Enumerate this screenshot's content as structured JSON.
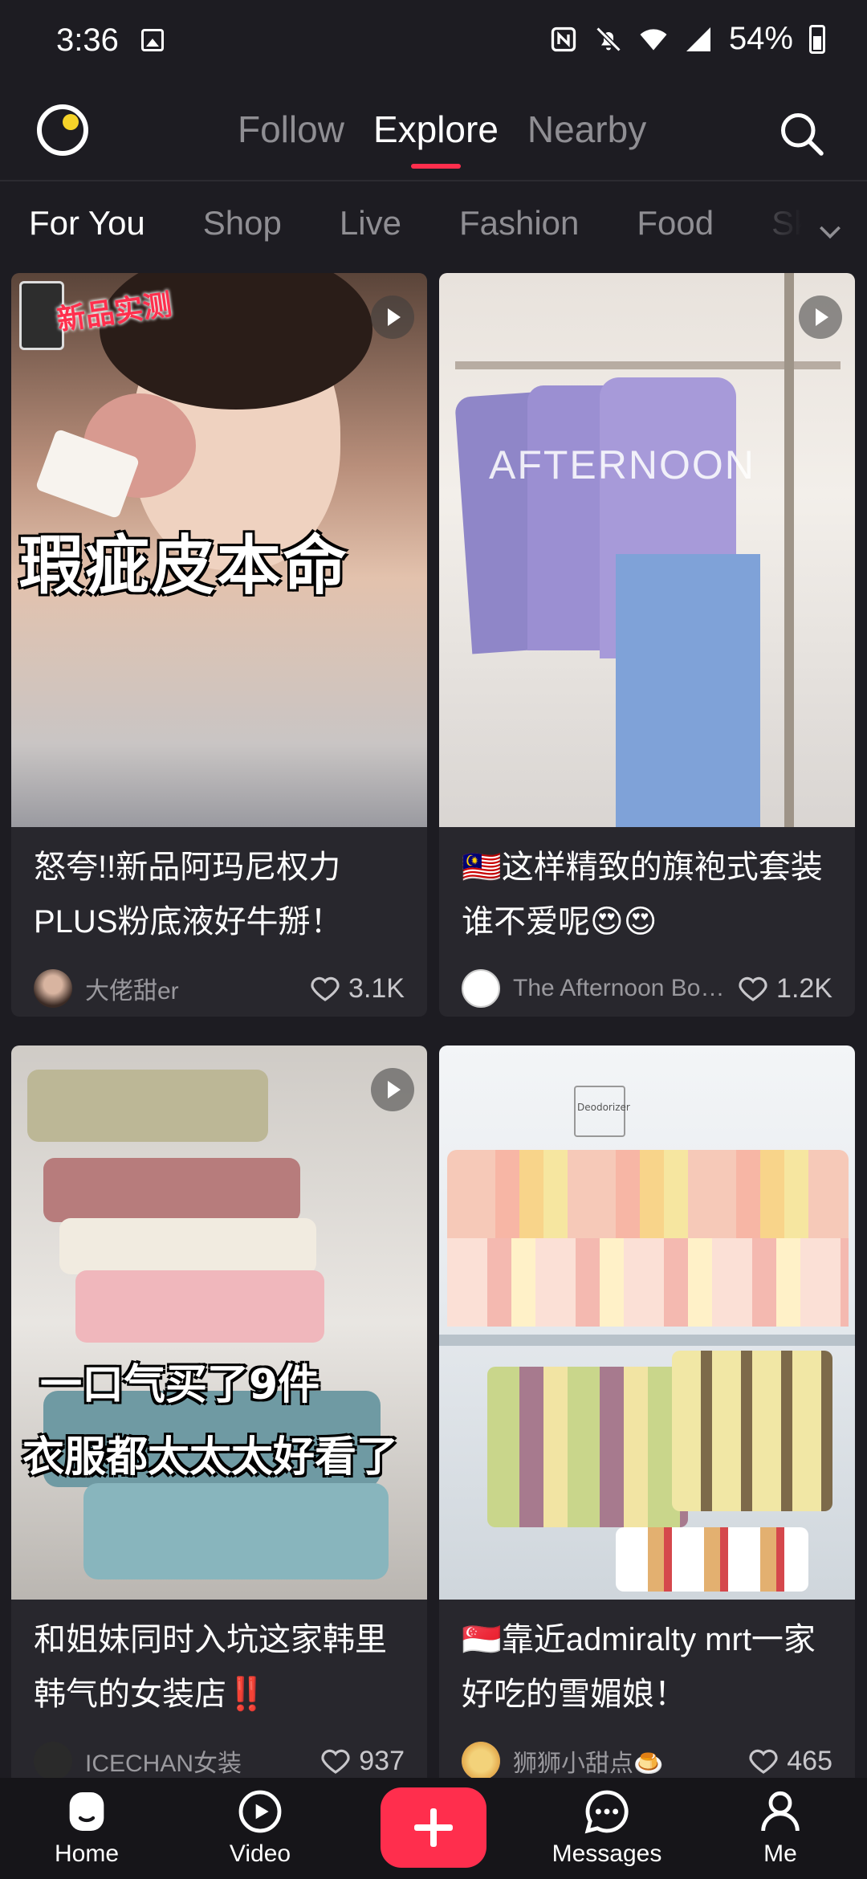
{
  "status": {
    "time": "3:36",
    "battery": "54%"
  },
  "nav": {
    "tabs": [
      "Follow",
      "Explore",
      "Nearby"
    ],
    "active_tab": "Explore"
  },
  "categories": [
    "For You",
    "Shop",
    "Live",
    "Fashion",
    "Food",
    "Sk"
  ],
  "posts": [
    {
      "overlay": "新品实测",
      "overlay2": "瑕疵皮本命",
      "title": "怒夸!!新品阿玛尼权力PLUS粉底液好牛掰！",
      "author": "大佬甜er",
      "likes": "3.1K"
    },
    {
      "overlay": "AFTERNOON",
      "title": "🇲🇾这样精致的旗袍式套装谁不爱呢😍😍",
      "author": "The Afternoon Bout...",
      "likes": "1.2K"
    },
    {
      "overlay": "一口气买了9件",
      "overlay2": "衣服都太太太好看了",
      "title": "和姐妹同时入坑这家韩里韩气的女装店‼️",
      "author": "ICECHAN女装",
      "likes": "937"
    },
    {
      "overlay": "Deodorizer",
      "title": "🇸🇬靠近admiralty mrt一家好吃的雪媚娘！",
      "author": "狮狮小甜点🍮",
      "likes": "465"
    }
  ],
  "bottom_nav": [
    "Home",
    "Video",
    "Messages",
    "Me"
  ]
}
